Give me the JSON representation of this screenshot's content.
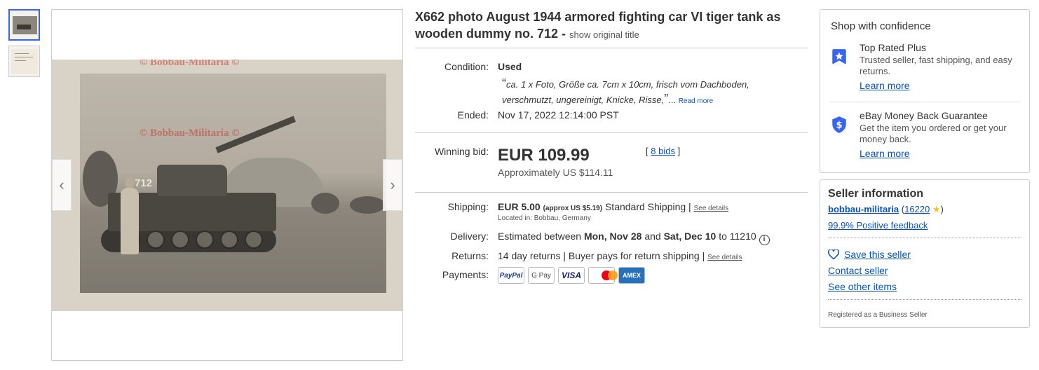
{
  "gallery": {
    "watermark": "© Bobbau-Militaria ©",
    "tank_number": "712"
  },
  "listing": {
    "title": "X662 photo August 1944 armored fighting car VI tiger tank as wooden dummy no. 712 -",
    "show_original": "show original title"
  },
  "condition": {
    "label": "Condition:",
    "value": "Used",
    "quote_open": "“",
    "quote": "ca. 1 x Foto, Größe ca. 7cm x 10cm, frisch vom Dachboden, verschmutzt, ungereinigt, Knicke, Risse,",
    "quote_close": "”",
    "ellipsis": "...",
    "read_more": "Read more"
  },
  "ended": {
    "label": "Ended:",
    "value": "Nov 17, 2022 12:14:00 PST"
  },
  "bid": {
    "label": "Winning bid:",
    "price": "EUR 109.99",
    "approx": "Approximately US $114.11",
    "bids_open": "[",
    "bids_link": "8 bids",
    "bids_close": "]"
  },
  "shipping": {
    "label": "Shipping:",
    "price": "EUR 5.00",
    "approx": "(approx US $5.19)",
    "method": "Standard Shipping |",
    "details_link": "See details",
    "location": "Located in: Bobbau, Germany"
  },
  "delivery": {
    "label": "Delivery:",
    "prefix": "Estimated between",
    "start": "Mon, Nov 28",
    "and": "and",
    "end": "Sat, Dec 10",
    "suffix": "to 11210",
    "info_icon": "i"
  },
  "returns": {
    "label": "Returns:",
    "value": "14 day returns | Buyer pays for return shipping |",
    "details_link": "See details"
  },
  "payments": {
    "label": "Payments:",
    "methods": [
      "PayPal",
      "G Pay",
      "VISA",
      "mastercard",
      "AMEX"
    ]
  },
  "confidence": {
    "title": "Shop with confidence",
    "top_rated": {
      "heading": "Top Rated Plus",
      "text": "Trusted seller, fast shipping, and easy returns.",
      "link": "Learn more"
    },
    "guarantee": {
      "heading": "eBay Money Back Guarantee",
      "text": "Get the item you ordered or get your money back.",
      "link": "Learn more"
    }
  },
  "seller": {
    "title": "Seller information",
    "name": "bobbau-militaria",
    "paren_open": "(",
    "score": "16220",
    "paren_close": ")",
    "feedback": "99.9% Positive feedback",
    "save": "Save this seller",
    "contact": "Contact seller",
    "other_items": "See other items",
    "registered": "Registered as a Business Seller"
  },
  "colors": {
    "link": "#0654ba",
    "accent_blue": "#3665f3",
    "star": "#f5c518"
  }
}
